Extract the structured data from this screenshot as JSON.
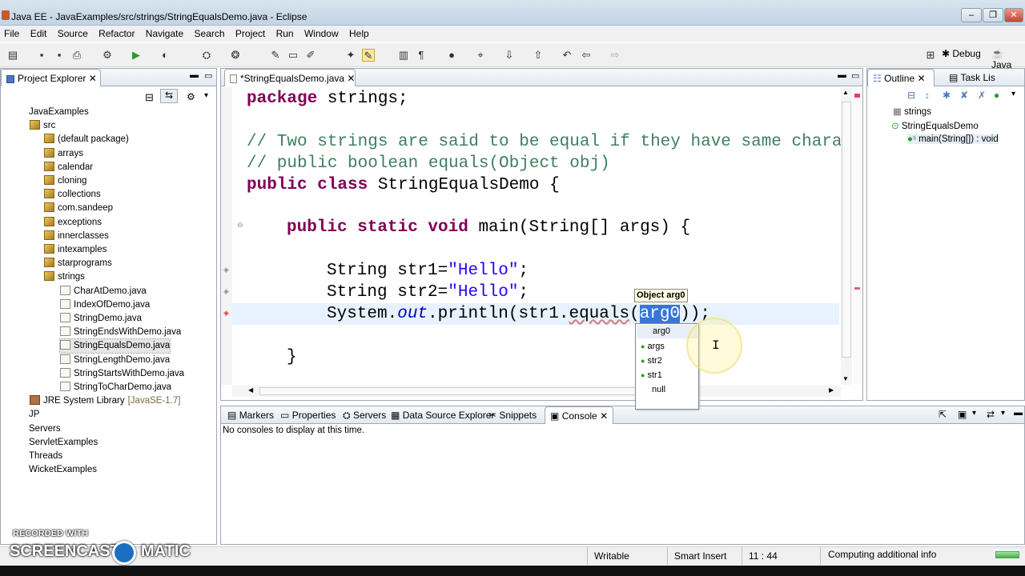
{
  "window": {
    "title": "Java EE - JavaExamples/src/strings/StringEqualsDemo.java - Eclipse"
  },
  "menu": [
    "File",
    "Edit",
    "Source",
    "Refactor",
    "Navigate",
    "Search",
    "Project",
    "Run",
    "Window",
    "Help"
  ],
  "perspectives": {
    "debug": "Debug",
    "java": "Java"
  },
  "explorer": {
    "tab": "Project Explorer",
    "items": [
      {
        "label": "JavaExamples",
        "type": "project",
        "depth": 0
      },
      {
        "label": "src",
        "type": "pkg",
        "depth": 1
      },
      {
        "label": "(default package)",
        "type": "pkg",
        "depth": 2
      },
      {
        "label": "arrays",
        "type": "pkg",
        "depth": 2
      },
      {
        "label": "calendar",
        "type": "pkg",
        "depth": 2
      },
      {
        "label": "cloning",
        "type": "pkg",
        "depth": 2
      },
      {
        "label": "collections",
        "type": "pkg",
        "depth": 2
      },
      {
        "label": "com.sandeep",
        "type": "pkg",
        "depth": 2
      },
      {
        "label": "exceptions",
        "type": "pkg",
        "depth": 2
      },
      {
        "label": "innerclasses",
        "type": "pkg",
        "depth": 2
      },
      {
        "label": "intexamples",
        "type": "pkg",
        "depth": 2
      },
      {
        "label": "starprograms",
        "type": "pkg",
        "depth": 2
      },
      {
        "label": "strings",
        "type": "pkg",
        "depth": 2
      },
      {
        "label": "CharAtDemo.java",
        "type": "file",
        "depth": 3
      },
      {
        "label": "IndexOfDemo.java",
        "type": "file",
        "depth": 3
      },
      {
        "label": "StringDemo.java",
        "type": "file",
        "depth": 3
      },
      {
        "label": "StringEndsWithDemo.java",
        "type": "file",
        "depth": 3
      },
      {
        "label": "StringEqualsDemo.java",
        "type": "file",
        "depth": 3
      },
      {
        "label": "StringLengthDemo.java",
        "type": "file",
        "depth": 3
      },
      {
        "label": "StringStartsWithDemo.java",
        "type": "file",
        "depth": 3
      },
      {
        "label": "StringToCharDemo.java",
        "type": "file",
        "depth": 3
      },
      {
        "label": "JRE System Library",
        "type": "lib",
        "depth": 1,
        "suffix": "[JavaSE-1.7]"
      },
      {
        "label": "JP",
        "type": "project",
        "depth": 0
      },
      {
        "label": "Servers",
        "type": "project",
        "depth": 0
      },
      {
        "label": "ServletExamples",
        "type": "project",
        "depth": 0
      },
      {
        "label": "Threads",
        "type": "project",
        "depth": 0
      },
      {
        "label": "WicketExamples",
        "type": "project",
        "depth": 0
      }
    ]
  },
  "editor": {
    "tab": "*StringEqualsDemo.java",
    "lines": {
      "l1_kw": "package",
      "l1_rest": " strings;",
      "l2": "// Two strings are said to be equal if they have same charac",
      "l3": "// public boolean equals(Object obj)",
      "l4_kw": "public class",
      "l4_rest": " StringEqualsDemo {",
      "l5_kw": "public static void",
      "l5_rest": " main(String[] args) {",
      "l6_a": "String str1=",
      "l6_s": "\"Hello\"",
      "l6_b": ";",
      "l7_a": "String str2=",
      "l7_s": "\"Hello\"",
      "l7_b": ";",
      "l8_a": "System.",
      "l8_out": "out",
      "l8_b": ".println(str1.",
      "l8_eq": "equals",
      "l8_c": "(",
      "l8_arg": "arg0",
      "l8_d": "));",
      "l9": "}"
    }
  },
  "autocomplete": {
    "hint": "Object arg0",
    "items": [
      "arg0",
      "args",
      "str2",
      "str1",
      "null"
    ]
  },
  "outline": {
    "tabs": [
      "Outline",
      "Task Lis"
    ],
    "items": [
      {
        "label": "strings",
        "depth": 0
      },
      {
        "label": "StringEqualsDemo",
        "depth": 0
      },
      {
        "label": "main(String[]) : void",
        "depth": 1
      }
    ]
  },
  "bottom": {
    "tabs": [
      "Markers",
      "Properties",
      "Servers",
      "Data Source Explorer",
      "Snippets",
      "Console"
    ],
    "console_message": "No consoles to display at this time."
  },
  "status": {
    "writable": "Writable",
    "insert": "Smart Insert",
    "position": "11 : 44",
    "progress": "Computing additional info"
  },
  "watermark": {
    "top": "RECORDED WITH",
    "bottom_left": "SCREENCAST",
    "bottom_right": "MATIC"
  }
}
